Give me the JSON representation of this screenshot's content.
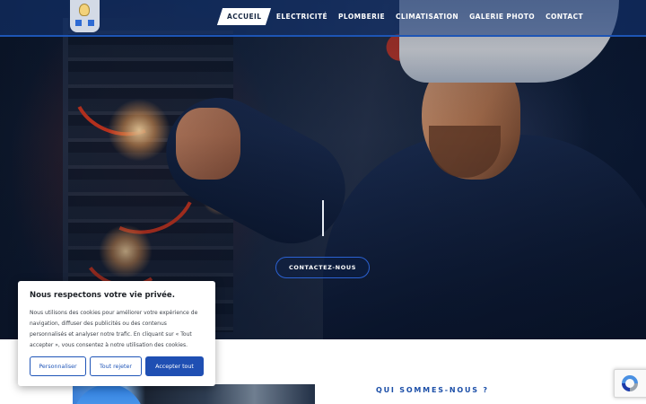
{
  "header": {
    "logo_name": "electrician-logo",
    "nav": [
      {
        "label": "ACCUEIL",
        "active": true
      },
      {
        "label": "ELECTRICITÉ",
        "active": false
      },
      {
        "label": "PLOMBERIE",
        "active": false
      },
      {
        "label": "CLIMATISATION",
        "active": false
      },
      {
        "label": "GALERIE PHOTO",
        "active": false
      },
      {
        "label": "CONTACT",
        "active": false
      }
    ]
  },
  "hero": {
    "cta_label": "CONTACTEZ-NOUS"
  },
  "about": {
    "heading": "QUI SOMMES-NOUS ?"
  },
  "cookie_banner": {
    "title": "Nous respectons votre vie privée.",
    "text": "Nous utilisons des cookies pour améliorer votre expérience de navigation, diffuser des publicités ou des contenus personnalisés et analyser notre trafic. En cliquant sur « Tout accepter », vous consentez à notre utilisation des cookies.",
    "customize_label": "Personnaliser",
    "reject_label": "Tout rejeter",
    "accept_label": "Accepter tout"
  },
  "colors": {
    "accent": "#1f4fb3",
    "header_bar": "#1d55b5",
    "about_heading": "#1c4fa8"
  },
  "icons": {
    "recaptcha": "recaptcha-icon"
  }
}
